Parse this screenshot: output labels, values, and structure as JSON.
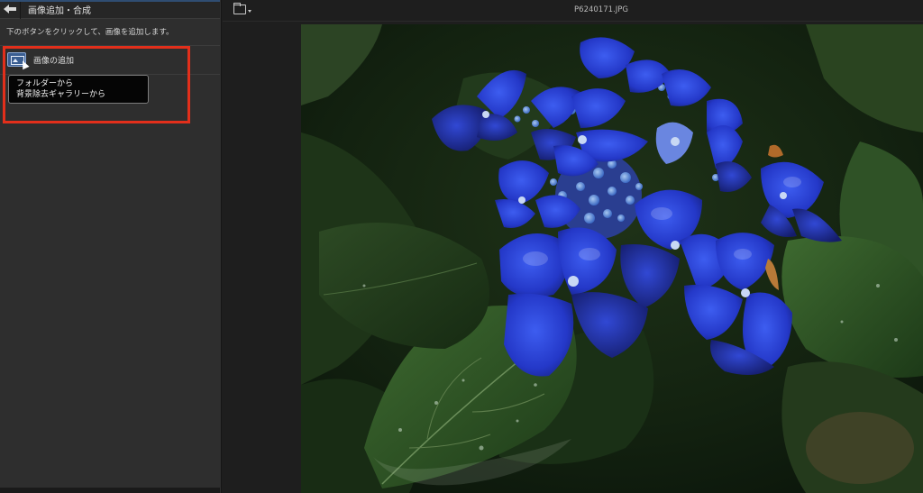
{
  "panel": {
    "title": "画像追加・合成",
    "instruction": "下のボタンをクリックして、画像を追加します。",
    "add_button_label": "画像の追加",
    "dropdown_items": [
      {
        "label": "フォルダーから"
      },
      {
        "label": "背景除去ギャラリーから"
      }
    ],
    "highlight_color": "#e22f1b"
  },
  "viewer": {
    "filename": "P6240171.JPG"
  },
  "icons": {
    "back": "back-arrow-icon",
    "add_image": "add-image-icon",
    "folder": "folder-icon"
  }
}
